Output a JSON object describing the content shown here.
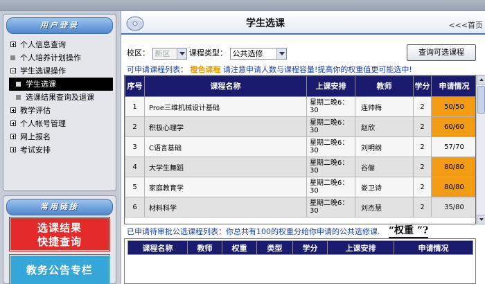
{
  "sidebar": {
    "login_panel_title": "用户登录",
    "menu": [
      {
        "label": "个人信息查询",
        "kind": "plus"
      },
      {
        "label": "个人培养计划操作",
        "kind": "square"
      },
      {
        "label": "学生选课操作",
        "kind": "minus"
      },
      {
        "label": "学生选课",
        "kind": "square-active"
      },
      {
        "label": "选课结果查询及退课",
        "kind": "square-sub"
      },
      {
        "label": "教学评估",
        "kind": "plus"
      },
      {
        "label": "个人帐号管理",
        "kind": "plus"
      },
      {
        "label": "网上报名",
        "kind": "plus"
      },
      {
        "label": "考试安排",
        "kind": "plus"
      }
    ],
    "links_panel_title": "常用链接",
    "quick_query_line1": "选课结果",
    "quick_query_line2": "快捷查询",
    "notice_label": "教务公告专栏"
  },
  "main": {
    "title": "学生选课",
    "home_link": "<<<首页",
    "campus_label": "校区：",
    "campus_value": "新区",
    "type_label": "课程类型：",
    "type_value": "公共选修",
    "query_button": "查询可选课程",
    "hint_prefix": "可申请课程列表：",
    "hint_orange": "橙色课程",
    "hint_suffix": "请注意申请人数与课程容量!提高你的权重值更可能选中!",
    "columns": [
      "序号",
      "课程名称",
      "上课安排",
      "教师",
      "学分",
      "申请情况"
    ],
    "courses": [
      {
        "no": "1",
        "name": "Proe三维机械设计基础",
        "sched1": "星期二晚6：",
        "sched2": "30",
        "teacher": "连帅梅",
        "credit": "2",
        "status": "50/50",
        "full": true
      },
      {
        "no": "2",
        "name": "积极心理学",
        "sched1": "星期二晚6：",
        "sched2": "30",
        "teacher": "赵欣",
        "credit": "2",
        "status": "60/60",
        "full": true
      },
      {
        "no": "3",
        "name": "C语言基础",
        "sched1": "星期二晚6：",
        "sched2": "30",
        "teacher": "刘明纲",
        "credit": "2",
        "status": "57/70",
        "full": false
      },
      {
        "no": "4",
        "name": "大学生舞蹈",
        "sched1": "星期二晚6：",
        "sched2": "30",
        "teacher": "谷俪",
        "credit": "2",
        "status": "80/80",
        "full": true
      },
      {
        "no": "5",
        "name": "家庭教育学",
        "sched1": "星期二晚6：",
        "sched2": "30",
        "teacher": "娄卫诗",
        "credit": "2",
        "status": "80/80",
        "full": true
      },
      {
        "no": "6",
        "name": "材料科学",
        "sched1": "星期二晚6：",
        "sched2": "30",
        "teacher": "刘杰慧",
        "credit": "2",
        "status": "35/80",
        "full": false
      }
    ],
    "applied_line": "已申请待审批公选课程列表：你总共有100的权重分给你申请的公共选修课.",
    "weight_label": "“权重 ”?",
    "applied_columns": [
      "课程名称",
      "教师",
      "权重",
      "类型",
      "学分",
      "上课安排",
      "申请情况"
    ],
    "colors": {
      "header_navy": "#1a1a6e",
      "full_orange": "#f39b12",
      "hint_blue": "#1a3fb0"
    }
  }
}
